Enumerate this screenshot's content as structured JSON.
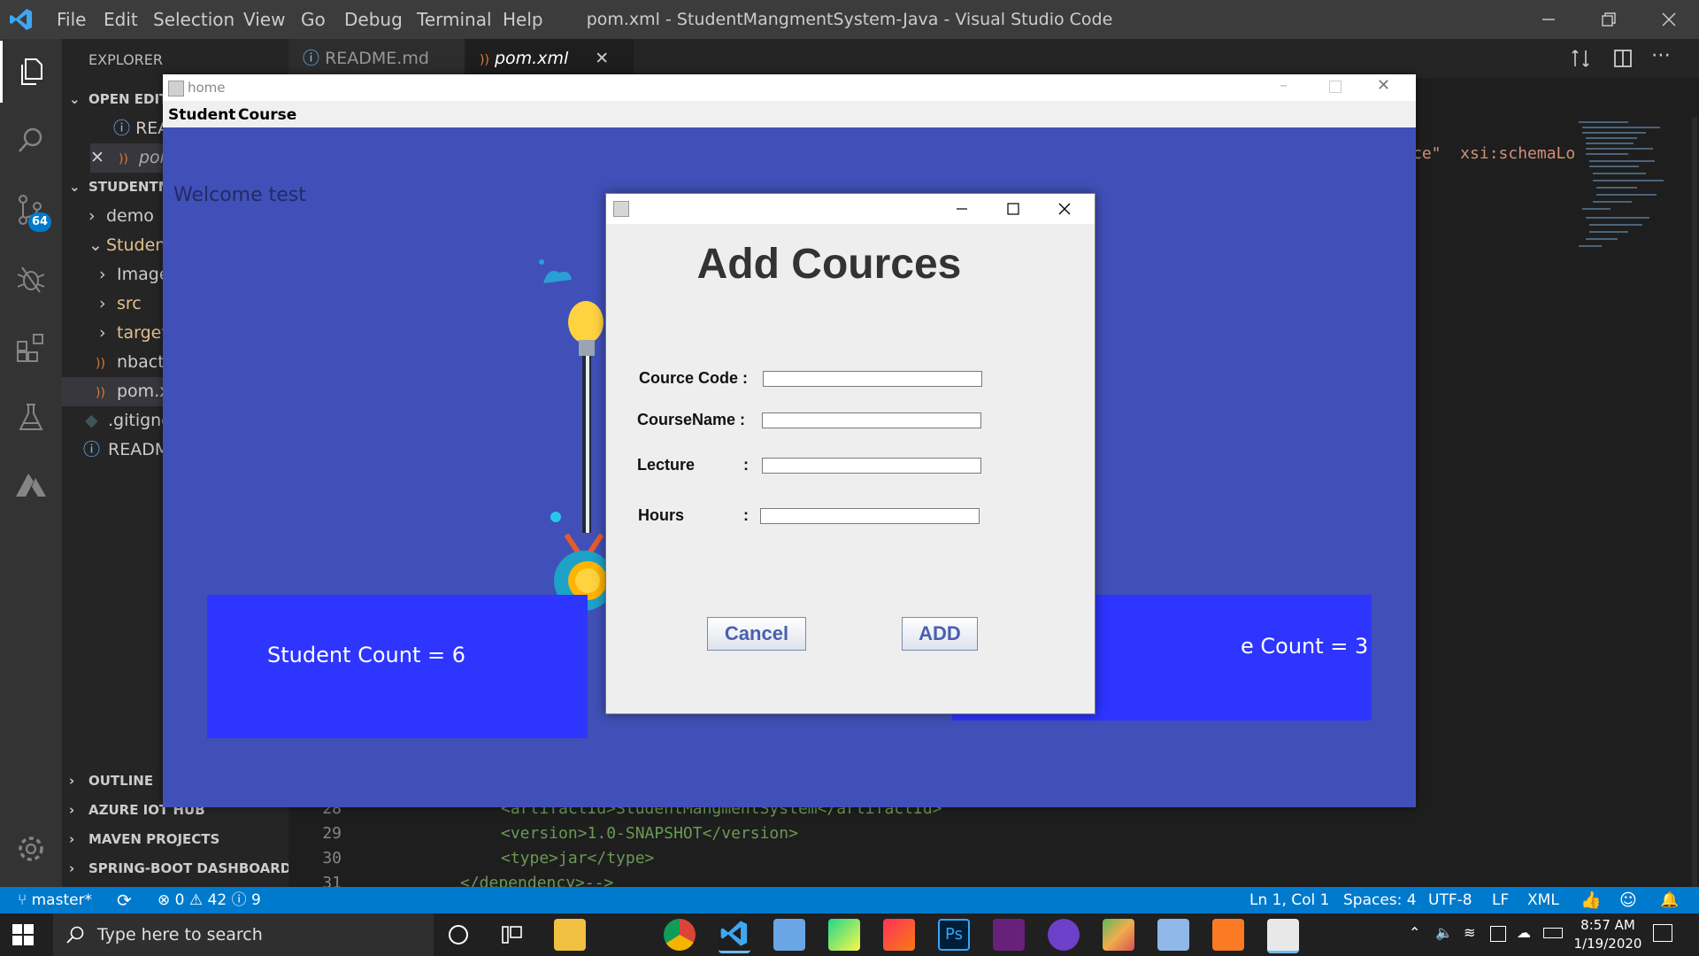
{
  "vscode": {
    "menu": [
      "File",
      "Edit",
      "Selection",
      "View",
      "Go",
      "Debug",
      "Terminal",
      "Help"
    ],
    "window_title": "pom.xml - StudentMangmentSystem-Java - Visual Studio Code",
    "activity_badge": "64",
    "explorer_title": "EXPLORER",
    "sidebar": {
      "open_editors": "OPEN EDIT",
      "open_items": [
        "REA",
        "por"
      ],
      "project": "STUDENTM",
      "tree": [
        "demo",
        "Studen",
        "Image",
        "src",
        "target",
        "nbact",
        "pom.x",
        ".gitignc",
        "READM"
      ],
      "bottom_sections": [
        "OUTLINE",
        "AZURE IOT HUB",
        "MAVEN PROJECTS",
        "SPRING-BOOT DASHBOARD"
      ]
    },
    "tabs": [
      {
        "label": "README.md",
        "active": false
      },
      {
        "label": "pom.xml",
        "active": true
      }
    ],
    "code": {
      "visible_fragment": "ce\"  xsi:schemaLo",
      "line_numbers": [
        "28",
        "29",
        "30",
        "31"
      ],
      "lines": [
        "<artifactId>StudentMangmentSystem</artifactId>",
        "<version>1.0-SNAPSHOT</version>",
        "<type>jar</type>",
        "</dependency>-->"
      ]
    },
    "status": {
      "branch": "master*",
      "errors": "0",
      "warnings": "42",
      "infos": "9",
      "position": "Ln 1, Col 1",
      "spaces": "Spaces: 4",
      "encoding": "UTF-8",
      "eol": "LF",
      "language": "XML"
    }
  },
  "home_window": {
    "title": "home",
    "menu": [
      "Student",
      "Course"
    ],
    "welcome": "Welcome test",
    "student_count": "Student Count = 6",
    "course_count_partial": "e Count = 3"
  },
  "dialog": {
    "heading": "Add Cources",
    "fields": [
      {
        "label": "Cource Code :",
        "value": ""
      },
      {
        "label": "CourseName :",
        "value": ""
      },
      {
        "label": "Lecture",
        "colon": ":",
        "value": ""
      },
      {
        "label": "Hours",
        "colon": ":",
        "value": ""
      }
    ],
    "cancel_label": "Cancel",
    "add_label": "ADD"
  },
  "taskbar": {
    "search_placeholder": "Type here to search",
    "time": "8:57 AM",
    "date": "1/19/2020"
  },
  "colors": {
    "vscode_blue": "#007acc",
    "home_bg": "#4050b8",
    "count_box": "#2d35ff",
    "dialog_bg": "#eeeeee"
  }
}
